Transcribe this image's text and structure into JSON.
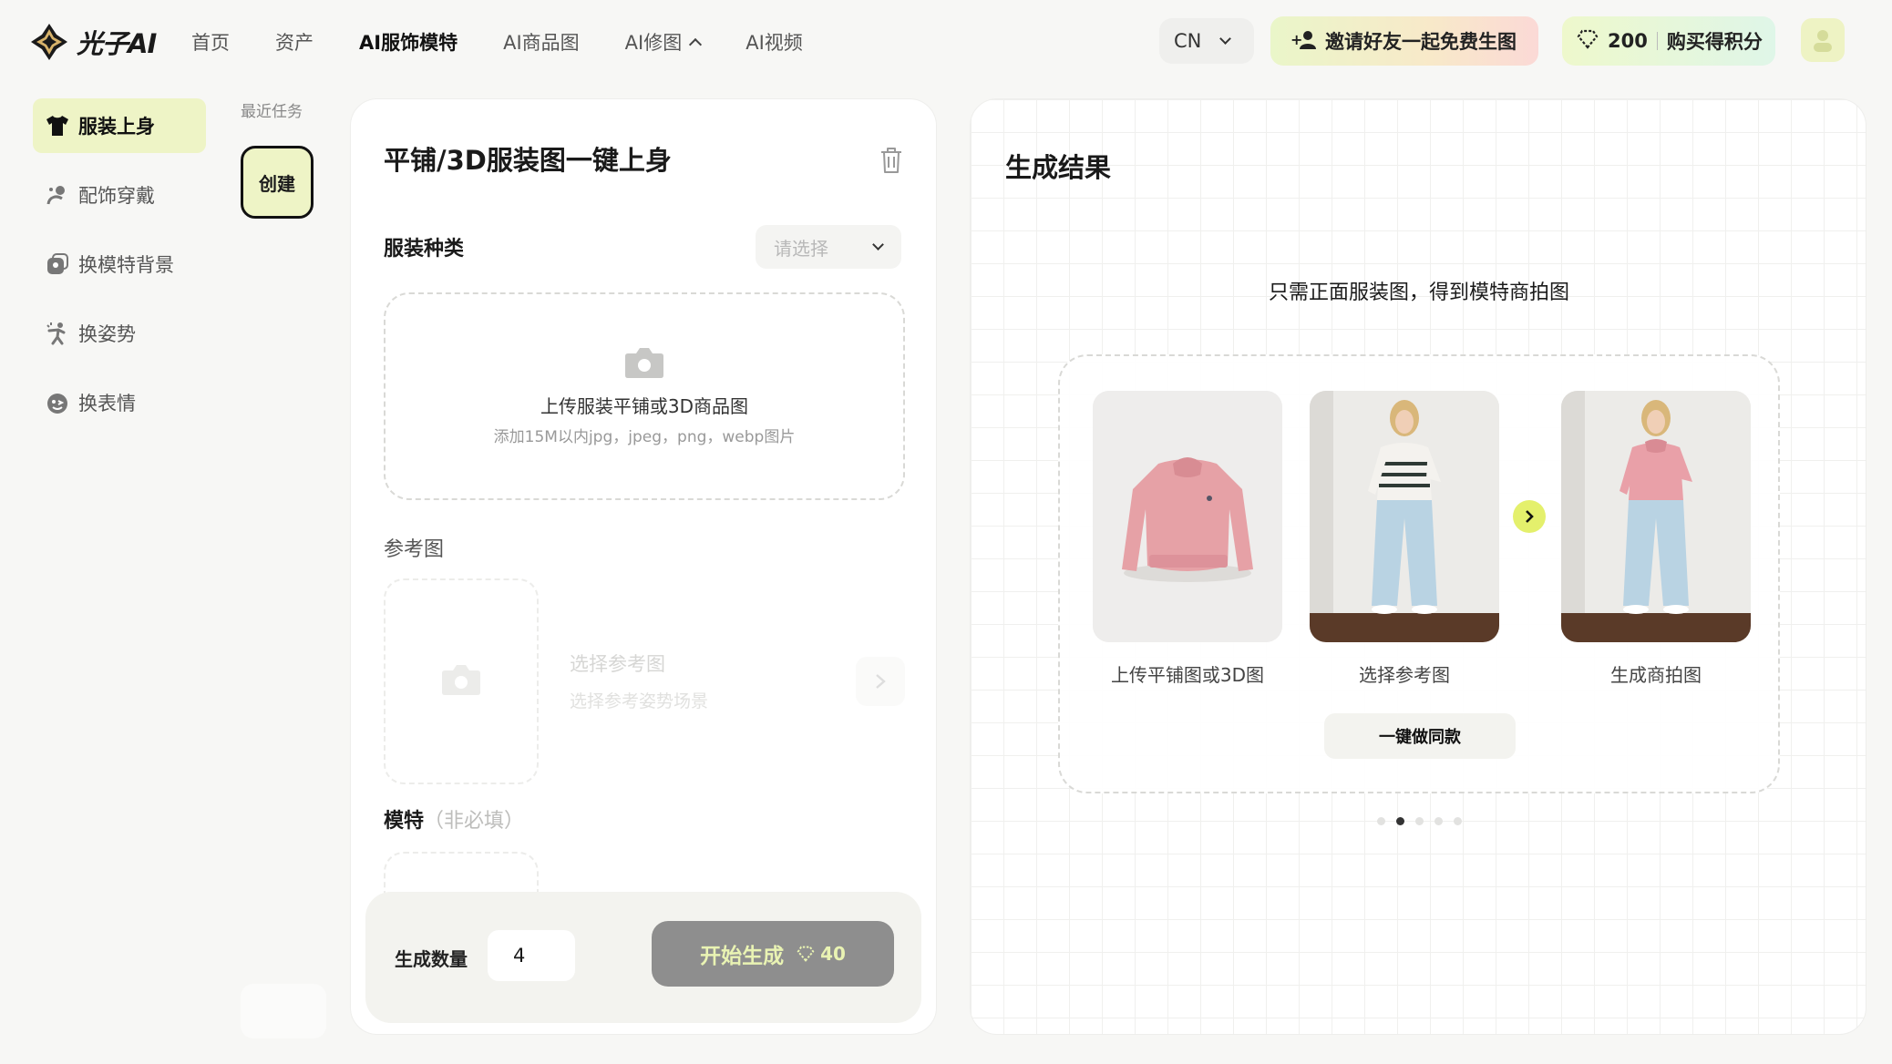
{
  "brand": {
    "name": "光子AI"
  },
  "nav": {
    "items": [
      {
        "label": "首页"
      },
      {
        "label": "资产"
      },
      {
        "label": "AI服饰模特",
        "active": true
      },
      {
        "label": "AI商品图"
      },
      {
        "label": "AI修图",
        "has_dropdown": true
      },
      {
        "label": "AI视频"
      }
    ]
  },
  "header": {
    "language": "CN",
    "invite_label": "邀请好友一起免费生图",
    "credits_value": "200",
    "buy_credits_label": "购买得积分"
  },
  "sidebar": {
    "items": [
      {
        "label": "服装上身",
        "icon": "shirt-icon",
        "active": true
      },
      {
        "label": "配饰穿戴",
        "icon": "accessory-icon"
      },
      {
        "label": "换模特背景",
        "icon": "swap-background-icon"
      },
      {
        "label": "换姿势",
        "icon": "pose-icon"
      },
      {
        "label": "换表情",
        "icon": "expression-icon"
      }
    ],
    "recent_label": "最近任务",
    "create_label": "创建"
  },
  "form": {
    "title": "平铺/3D服装图一键上身",
    "type_label": "服装种类",
    "type_placeholder": "请选择",
    "upload_main": "上传服装平铺或3D商品图",
    "upload_sub": "添加15M以内jpg，jpeg，png，webp图片",
    "ref_label": "参考图",
    "ref_title": "选择参考图",
    "ref_sub": "选择参考姿势场景",
    "model_label": "模特",
    "model_optional": "（非必填）",
    "count_label": "生成数量",
    "count_value": "4",
    "start_label": "开始生成",
    "start_cost": "40"
  },
  "result": {
    "title": "生成结果",
    "hint": "只需正面服装图，得到模特商拍图",
    "steps": [
      {
        "caption": "上传平铺图或3D图"
      },
      {
        "caption": "选择参考图"
      },
      {
        "caption": "生成商拍图"
      }
    ],
    "same_style_label": "一键做同款",
    "carousel": {
      "count": 5,
      "active_index": 1
    }
  },
  "colors": {
    "accent": "#eef4c6",
    "accent_strong": "#e4f06c",
    "button_disabled": "#8e8e8e"
  }
}
